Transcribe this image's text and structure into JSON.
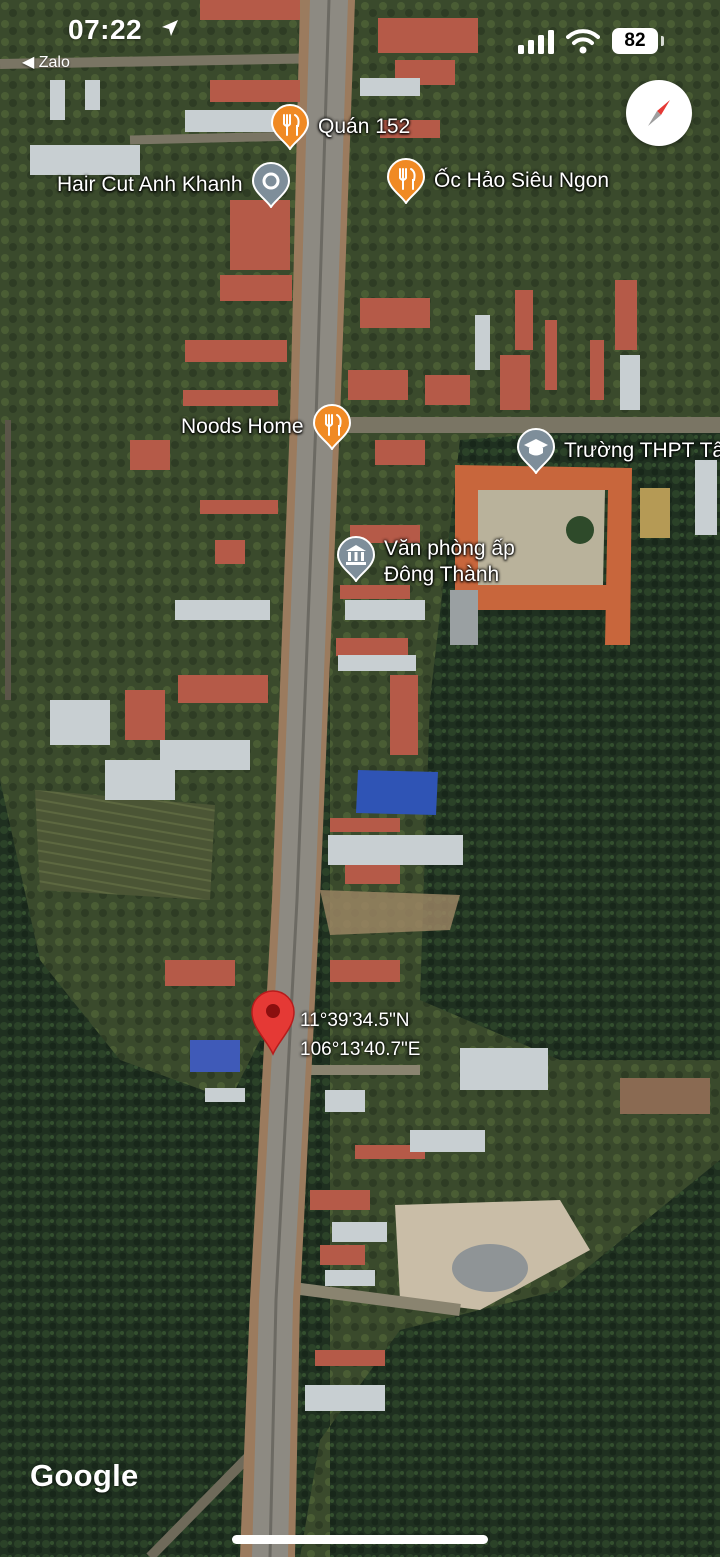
{
  "status_bar": {
    "time": "07:22",
    "back_label": "Zalo",
    "battery": "82"
  },
  "map": {
    "type": "satellite",
    "pois": [
      {
        "name": "Quán 152",
        "icon": "restaurant-icon",
        "color": "#f08a24"
      },
      {
        "name": "Hair Cut Anh Khanh",
        "icon": "location-icon",
        "color": "#7e8e9a"
      },
      {
        "name": "Ốc Hảo Siêu Ngon",
        "icon": "restaurant-icon",
        "color": "#f08a24"
      },
      {
        "name": "Noods Home",
        "icon": "restaurant-icon",
        "color": "#f08a24"
      },
      {
        "name": "Trường THPT Tâ",
        "icon": "school-icon",
        "color": "#7e8e9a"
      },
      {
        "name": "Văn phòng ấp Đông Thành",
        "icon": "government-icon",
        "color": "#7e8e9a"
      }
    ],
    "dropped_pin": {
      "lat": "11°39'34.5\"N",
      "lng": "106°13'40.7\"E",
      "color": "#e53935"
    },
    "attribution": "Google"
  }
}
